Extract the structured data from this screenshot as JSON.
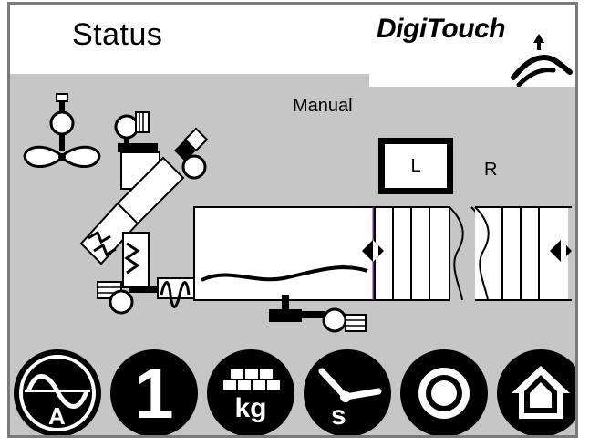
{
  "header": {
    "title": "Status",
    "logo_text": "DigiTouch"
  },
  "mode": {
    "label": "Manual",
    "left_label": "L",
    "right_label": "R",
    "selected": "L"
  },
  "diagram": {
    "icons": [
      "fan-icon",
      "motor-icon",
      "valve-icon",
      "screw-conveyor-icon",
      "actuator-icon",
      "gate-valve-icon"
    ]
  },
  "nav": {
    "buttons": [
      {
        "id": "analog",
        "label": "A",
        "icon": "sine-wave-icon"
      },
      {
        "id": "one",
        "label": "1",
        "icon": "number-one-icon"
      },
      {
        "id": "weight",
        "label": "kg",
        "icon": "weight-icon"
      },
      {
        "id": "time",
        "label": "s",
        "icon": "clock-icon"
      },
      {
        "id": "target",
        "label": "",
        "icon": "target-icon"
      },
      {
        "id": "home",
        "label": "",
        "icon": "home-icon"
      }
    ]
  },
  "colors": {
    "background": "#c6c6c6",
    "frame": "#7a7a7a",
    "accent_line": "#8a1a9a"
  }
}
